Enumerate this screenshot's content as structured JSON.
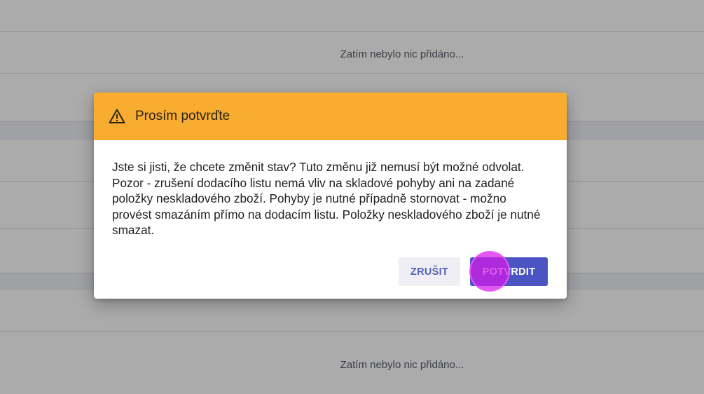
{
  "background": {
    "empty_text_top": "Zatím nebylo nic přidáno...",
    "empty_text_bottom": "Zatím nebylo nic přidáno..."
  },
  "dialog": {
    "title": "Prosím potvrďte",
    "icon": "warning-triangle-icon",
    "message": "Jste si jisti, že chcete změnit stav? Tuto změnu již nemusí být možné odvolat. Pozor - zrušení dodacího listu nemá vliv na skladové pohyby ani na zadané položky neskladového zboží. Pohyby je nutné případně stornovat - možno provést smazáním přímo na dodacím listu. Položky neskladového zboží je nutné smazat.",
    "cancel_label": "ZRUŠIT",
    "confirm_label": "POTVRDIT"
  },
  "colors": {
    "header": "#f8ac30",
    "confirm_button": "#4a55c3",
    "cancel_button_text": "#5561b8",
    "click_marker": "#d41ce6"
  }
}
